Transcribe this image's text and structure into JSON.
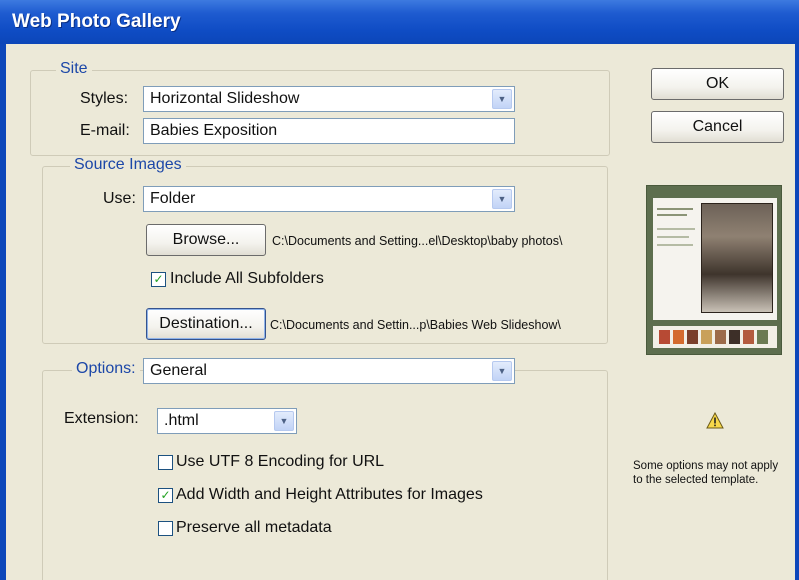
{
  "window": {
    "title": "Web Photo Gallery"
  },
  "site": {
    "legend": "Site",
    "styles_label": "Styles:",
    "styles_value": "Horizontal Slideshow",
    "email_label": "E-mail:",
    "email_value": "Babies Exposition"
  },
  "source": {
    "legend": "Source Images",
    "use_label": "Use:",
    "use_value": "Folder",
    "browse_label": "Browse...",
    "browse_path": "C:\\Documents and Setting...el\\Desktop\\baby photos\\",
    "include_subfolders_label": "Include All Subfolders",
    "include_subfolders_checked": true,
    "destination_label": "Destination...",
    "destination_path": "C:\\Documents and Settin...p\\Babies Web Slideshow\\"
  },
  "options": {
    "legend": "Options:",
    "value": "General",
    "extension_label": "Extension:",
    "extension_value": ".html",
    "utf8_label": "Use UTF 8 Encoding for URL",
    "utf8_checked": false,
    "width_height_label": "Add Width and Height Attributes for Images",
    "width_height_checked": true,
    "metadata_label": "Preserve all metadata",
    "metadata_checked": false
  },
  "buttons": {
    "ok": "OK",
    "cancel": "Cancel"
  },
  "note": "Some options may not apply to the selected template.",
  "icons": {
    "dropdown": "chevron-down-icon",
    "warning": "warning-icon",
    "check": "checkmark-icon"
  },
  "colors": {
    "title_bar": "#0f4cc4",
    "legend_text": "#1c47a8",
    "dialog_bg": "#ece9d8",
    "check_mark": "#21a121"
  }
}
